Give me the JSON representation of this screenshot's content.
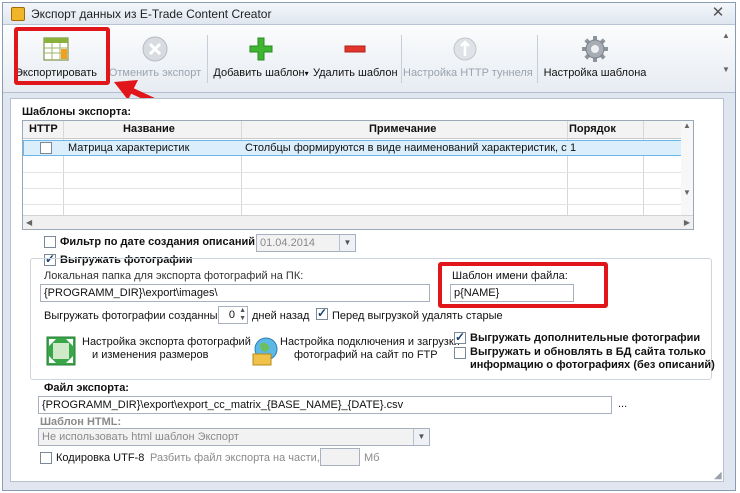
{
  "window": {
    "title": "Экспорт данных из E-Trade Content Creator",
    "close_glyph": "✕"
  },
  "toolbar": {
    "export_label": "Экспортировать",
    "cancel_export_label": "Отменить экспорт",
    "add_template_label": "Добавить шаблон",
    "add_template_arrow": "▾",
    "delete_template_label": "Удалить шаблон",
    "http_tunnel_label": "Настройка HTTP туннеля",
    "template_settings_label": "Настройка шаблона"
  },
  "templates": {
    "title": "Шаблоны экспорта:",
    "columns": [
      "HTTP",
      "Название",
      "Примечание",
      "Порядок"
    ],
    "rows": [
      {
        "http": false,
        "name": "Матрица характеристик",
        "note": "Столбцы формируются в виде наименований характеристик, строки",
        "order": "1"
      }
    ]
  },
  "filter": {
    "label": "Фильтр по дате создания описаний",
    "checked": false,
    "date": "01.04.2014"
  },
  "photos": {
    "upload_label": "Выгружать фотографии",
    "upload_checked": true,
    "folder_label": "Локальная папка для экспорта фотографий на ПК:",
    "folder_value": "{PROGRAMM_DIR}\\export\\images\\",
    "filename_template_label": "Шаблон имени файла:",
    "filename_template_value": "p{NAME}",
    "created_label": "Выгружать фотографии созданные",
    "days_value": "0",
    "days_suffix": "дней назад",
    "delete_old_label": "Перед выгрузкой удалять старые",
    "delete_old_checked": true,
    "resize_settings_label_1": "Настройка экспорта фотографий",
    "resize_settings_label_2": "и изменения размеров",
    "ftp_settings_label_1": "Настройка подключения и загрузки",
    "ftp_settings_label_2": "фотографий на сайт по FTP",
    "extra_photos_label": "Выгружать дополнительные фотографии",
    "extra_photos_checked": true,
    "update_db_label_1": "Выгружать и обновлять в БД сайта только",
    "update_db_label_2": "информацию о фотографиях (без описаний)",
    "update_db_checked": false
  },
  "export_file": {
    "label": "Файл экспорта:",
    "value": "{PROGRAMM_DIR}\\export\\export_cc_matrix_{BASE_NAME}_{DATE}.csv",
    "browse": "..."
  },
  "html_template": {
    "label": "Шаблон HTML:",
    "value": "Не использовать html шаблон Экспорт"
  },
  "encoding": {
    "label": "Кодировка UTF-8",
    "checked": false
  },
  "split": {
    "label": "Разбить файл экспорта на части, по:",
    "value": "",
    "unit": "Мб"
  },
  "colors": {
    "highlight_red": "#e0161b",
    "selection_blue": "#dbeefc"
  }
}
